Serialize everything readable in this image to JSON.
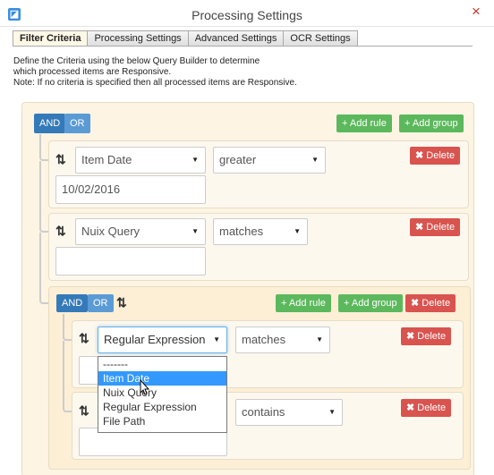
{
  "window": {
    "title": "Processing Settings",
    "close_glyph": "×"
  },
  "tabs": [
    {
      "label": "Filter Criteria",
      "active": true
    },
    {
      "label": "Processing Settings"
    },
    {
      "label": "Advanced Settings"
    },
    {
      "label": "OCR Settings"
    }
  ],
  "description": {
    "line1": "Define the Criteria using the below Query Builder to determine",
    "line2": "which processed items are Responsive.",
    "line3": "Note: If no criteria is specified then all processed items are Responsive."
  },
  "group": {
    "and_label": "AND",
    "or_label": "OR",
    "add_rule": "+ Add rule",
    "add_group": "+ Add group",
    "delete": "Delete",
    "sort_glyph": "⇅"
  },
  "rules": [
    {
      "field": "Item Date",
      "operator": "greater",
      "value": "10/02/2016"
    },
    {
      "field": "Nuix Query",
      "operator": "matches",
      "value": ""
    }
  ],
  "subgroup": {
    "rules": [
      {
        "field": "Regular Expression",
        "operator": "matches",
        "value": ""
      },
      {
        "field": "",
        "operator": "contains",
        "value": ""
      }
    ],
    "dropdown_options": [
      "-------",
      "Item Date",
      "Nuix Query",
      "Regular Expression",
      "File Path"
    ],
    "highlighted_option": "Item Date"
  },
  "icons": {
    "app": "app-icon",
    "close": "close-icon",
    "sort": "sort-icon",
    "delete": "times-icon",
    "add": "plus-icon",
    "add_group": "plus-circle-icon",
    "select_arrow": "caret-down-icon"
  },
  "colors": {
    "and_button": "#357ab8",
    "or_button": "#5b9bd5",
    "add_button": "#5cb85c",
    "delete_button": "#d9534f",
    "group_background": "#fdf4e3",
    "dropdown_highlight": "#3399ff"
  }
}
